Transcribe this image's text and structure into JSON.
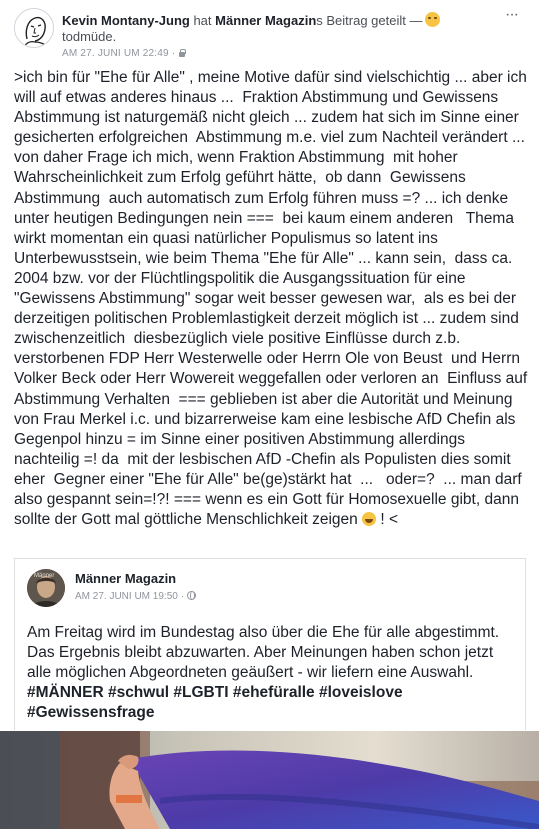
{
  "header": {
    "author": "Kevin Montany-Jung",
    "shared_text_pre": " hat ",
    "page_name": "Männer Magazin",
    "shared_text_post": "s Beitrag geteilt —",
    "feeling": "todmüde.",
    "timestamp": "AM 27. JUNI UM 22:49",
    "separator": "·",
    "more_label": "···"
  },
  "post": {
    "text": ">ich bin für \"Ehe für Alle\" , meine Motive dafür sind vielschichtig ... aber ich will auf etwas anderes hinaus ...  Fraktion Abstimmung und Gewissens Abstimmung ist naturgemäß nicht gleich ... zudem hat sich im Sinne einer gesicherten erfolgreichen  Abstimmung m.e. viel zum Nachteil verändert ... von daher Frage ich mich, wenn Fraktion Abstimmung  mit hoher Wahrscheinlichkeit zum Erfolg geführt hätte,  ob dann  Gewissens Abstimmung  auch automatisch zum Erfolg führen muss =? ... ich denke unter heutigen Bedingungen nein ===  bei kaum einem anderen   Thema  wirkt momentan ein quasi natürlicher Populismus so latent ins Unterbewusstsein, wie beim Thema \"Ehe für Alle\" ... kann sein,  dass ca. 2004 bzw. vor der Flüchtlingspolitik die Ausgangssituation für eine \"Gewissens Abstimmung\" sogar weit besser gewesen war,  als es bei der derzeitigen politischen Problemlastigkeit derzeit möglich ist ... zudem sind zwischenzeitlich  diesbezüglich viele positive Einflüsse durch z.b.   verstorbenen FDP Herr Westerwelle oder Herrn Ole von Beust  und Herrn Volker Beck oder Herr Wowereit weggefallen oder verloren an  Einfluss auf Abstimmung Verhalten  === geblieben ist aber die Autorität und Meinung von Frau Merkel i.c. und bizarrerweise kam eine lesbische AfD Chefin als Gegenpol hinzu = im Sinne einer positiven Abstimmung allerdings nachteilig =! da  mit der lesbischen AfD -Chefin als Populisten dies somit eher  Gegner einer \"Ehe für Alle\" be(ge)stärkt hat  ...   oder=?  ... man darf also gespannt sein=!?! === wenn es ein Gott für Homosexuelle gibt, dann sollte der Gott mal göttliche Menschlichkeit zeigen ",
    "text_end": " ! <"
  },
  "shared": {
    "page_name": "Männer Magazin",
    "avatar_label": "Männer",
    "timestamp": "AM 27. JUNI UM 19:50",
    "separator": "·",
    "text": "Am Freitag wird im Bundestag also über die Ehe für alle abgestimmt. Das Ergebnis bleibt abzuwarten. Aber Meinungen haben schon jetzt alle möglichen Abgeordneten geäußert - wir liefern eine Auswahl.",
    "hashtags": "#MÄNNER #schwul #LGBTI #ehefüralle #loveislove #Gewissensfrage"
  },
  "colors": {
    "text": "#1d2129",
    "meta": "#90949c",
    "border": "#dddfe2",
    "flag_purple": "#5b3fa8",
    "flag_blue": "#3a58c9"
  },
  "icons": {
    "avatar": "sketch-face-avatar",
    "feeling": "sleepy-emoji",
    "privacy": "lock-icon",
    "shared_privacy": "globe-icon",
    "laugh": "laughing-emoji",
    "more": "more-options-icon"
  }
}
